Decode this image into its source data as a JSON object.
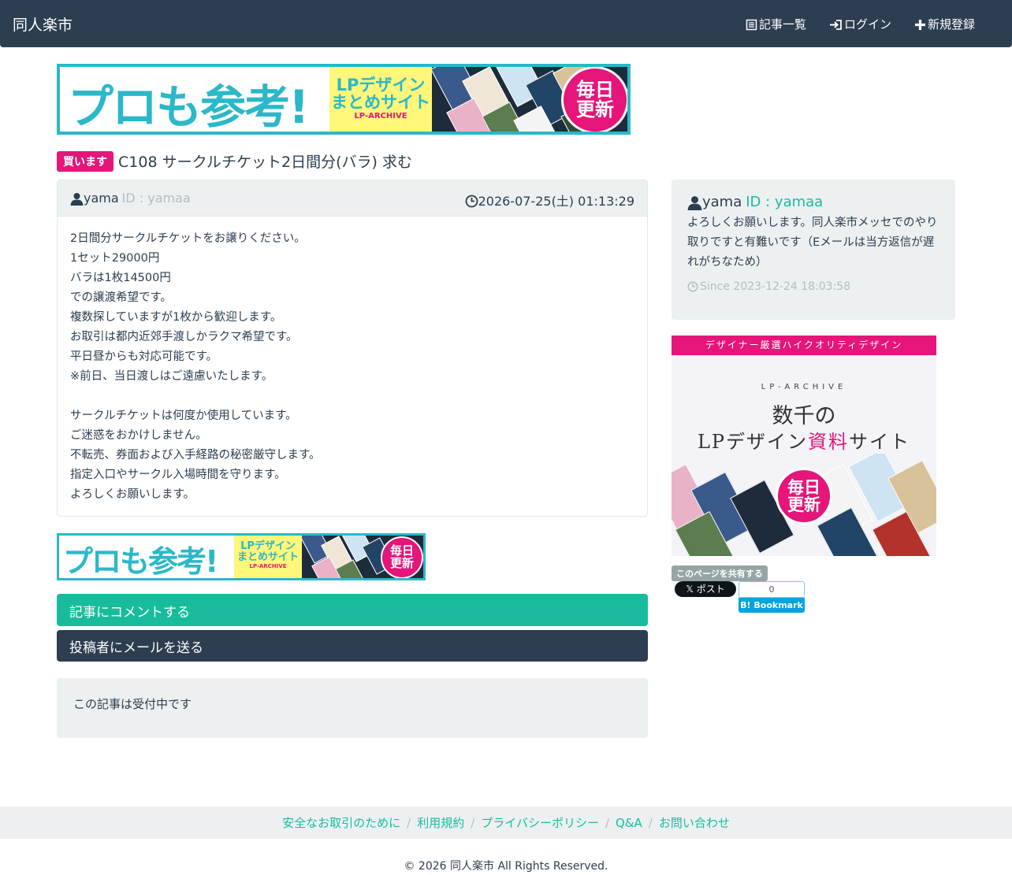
{
  "navbar": {
    "brand": "同人楽市",
    "items": [
      {
        "label": "記事一覧",
        "icon": "list-icon"
      },
      {
        "label": "ログイン",
        "icon": "login-icon"
      },
      {
        "label": "新規登録",
        "icon": "plus-icon"
      }
    ]
  },
  "banner_top": {
    "headline": "プロも参考!",
    "line1": "LPデザイン",
    "line2": "まとめサイト",
    "sub": "LP-ARCHIVE",
    "badge1": "毎日",
    "badge2": "更新"
  },
  "post": {
    "badge": "買います",
    "title": "C108 サークルチケット2日間分(バラ) 求む",
    "author": "yama",
    "author_id": "ID : yamaa",
    "date": "2026-07-25(土) 01:13:29",
    "body": [
      "2日間分サークルチケットをお譲りください。",
      "1セット29000円",
      "バラは1枚14500円",
      "での譲渡希望です。",
      "複数探していますが1枚から歓迎します。",
      "お取引は都内近郊手渡しかラクマ希望です。",
      "平日昼からも対応可能です。",
      "※前日、当日渡しはご遠慮いたします。",
      "",
      "サークルチケットは何度か使用しています。",
      "ご迷惑をおかけしません。",
      "不転売、券面および入手経路の秘密厳守します。",
      "指定入口やサークル入場時間を守ります。",
      "よろしくお願いします。"
    ]
  },
  "actions": {
    "comment": "記事にコメントする",
    "mail": "投稿者にメールを送る",
    "status": "この記事は受付中です"
  },
  "profile": {
    "name": "yama",
    "id": "ID : yamaa",
    "bio": "よろしくお願いします。同人楽市メッセでのやり取りですと有難いです（Eメールは当方返信が遅れがちなため）",
    "since": "Since 2023-12-24 18:03:58"
  },
  "side_ad": {
    "strip": "デザイナー厳選ハイクオリティデザイン",
    "brand": "LP-ARCHIVE",
    "line1": "数千の",
    "line2a": "LPデザイン",
    "line2b": "資料",
    "line2c": "サイト",
    "badge1": "毎日",
    "badge2": "更新"
  },
  "share": {
    "label": "このページを共有する",
    "x_label": "ポスト",
    "hatena_count": "0",
    "hatena_label": "Bookmark"
  },
  "footer": {
    "links": [
      "安全なお取引のために",
      "利用規約",
      "プライバシーポリシー",
      "Q&A",
      "お問い合わせ"
    ],
    "copyright": "© 2026 同人楽市 All Rights Reserved."
  },
  "colors": {
    "navbar": "#2c3e50",
    "accent": "#18bc9c",
    "pink": "#e5157a",
    "panel": "#ecf0f1",
    "banner_teal": "#2bb8c9"
  }
}
